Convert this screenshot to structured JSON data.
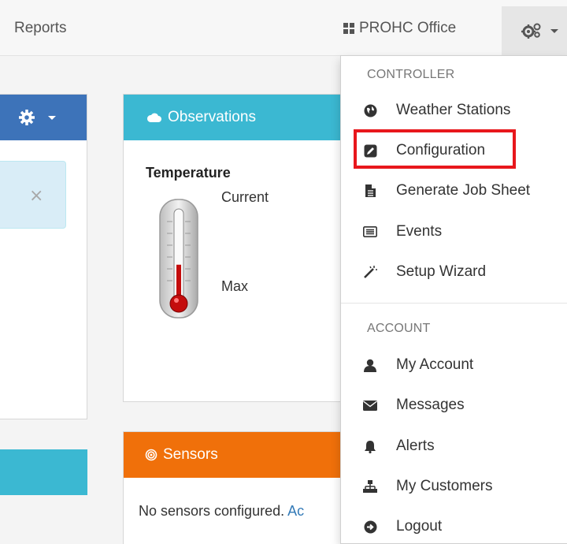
{
  "navbar": {
    "reports_label": "Reports",
    "office_label": "PROHC Office",
    "settings_icon": "gears-icon"
  },
  "observations": {
    "title": "Observations",
    "temperature_label": "Temperature",
    "current_label": "Current",
    "max_label": "Max",
    "thermometer_level": 0.42
  },
  "sensors": {
    "title": "Sensors",
    "empty_text": "No sensors configured.",
    "link_text": "Ac"
  },
  "alert": {
    "close_symbol": "×"
  },
  "dropdown": {
    "controller_header": "CONTROLLER",
    "account_header": "ACCOUNT",
    "controller_items": [
      {
        "label": "Weather Stations",
        "icon": "globe-icon"
      },
      {
        "label": "Configuration",
        "icon": "edit-icon"
      },
      {
        "label": "Generate Job Sheet",
        "icon": "file-icon"
      },
      {
        "label": "Events",
        "icon": "list-icon"
      },
      {
        "label": "Setup Wizard",
        "icon": "magic-wand-icon"
      }
    ],
    "account_items": [
      {
        "label": "My Account",
        "icon": "user-icon"
      },
      {
        "label": "Messages",
        "icon": "envelope-icon"
      },
      {
        "label": "Alerts",
        "icon": "bell-icon"
      },
      {
        "label": "My Customers",
        "icon": "sitemap-icon"
      },
      {
        "label": "Logout",
        "icon": "sign-out-icon"
      }
    ]
  },
  "colors": {
    "observations_header": "#3bb8d2",
    "sensors_header": "#f0700a",
    "left_panel_header": "#3d73b9",
    "highlight_border": "#e8171c"
  }
}
